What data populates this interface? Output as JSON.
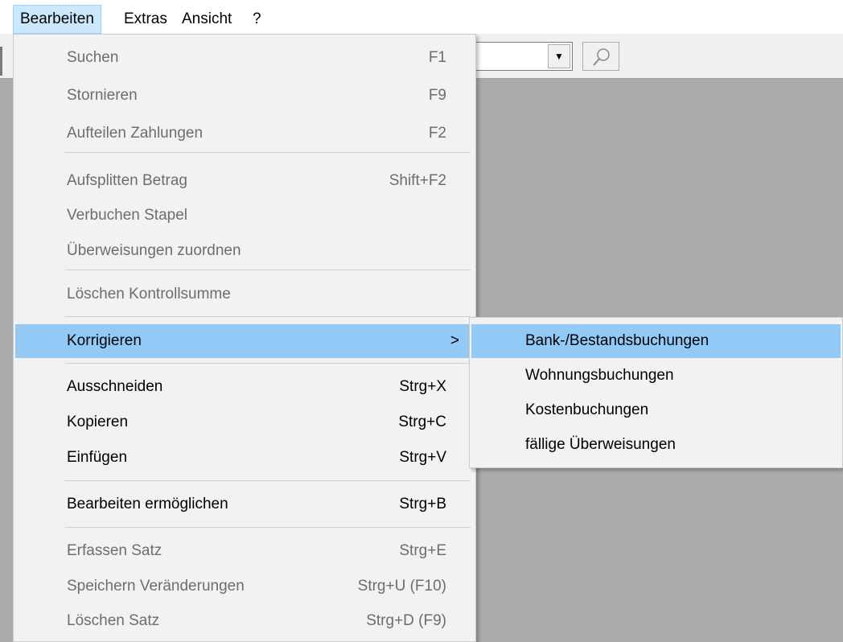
{
  "menubar": {
    "items": [
      {
        "label": "Bearbeiten",
        "active": true
      },
      {
        "label": "Extras"
      },
      {
        "label": "Ansicht"
      },
      {
        "label": "?"
      }
    ]
  },
  "colors": {
    "highlight": "#91c9f7",
    "menubar_active": "#cce8ff",
    "client_background": "#ababab",
    "disabled_text": "#6d6d6d"
  },
  "toolbar": {
    "combo_arrow_icon": "dropdown-arrow-icon",
    "search_icon": "magnifier-icon"
  },
  "menu": {
    "items": [
      {
        "label": "Suchen",
        "shortcut": "F1",
        "disabled": true
      },
      {
        "label": "Stornieren",
        "shortcut": "F9",
        "disabled": true
      },
      {
        "label": "Aufteilen Zahlungen",
        "shortcut": "F2",
        "disabled": true
      },
      {
        "label": "Aufsplitten Betrag",
        "shortcut": "Shift+F2",
        "disabled": true
      },
      {
        "label": "Verbuchen Stapel",
        "shortcut": "",
        "disabled": true
      },
      {
        "label": "Überweisungen zuordnen",
        "shortcut": "",
        "disabled": true
      },
      {
        "label": "Löschen Kontrollsumme",
        "shortcut": "",
        "disabled": true
      },
      {
        "label": "Korrigieren",
        "shortcut": "",
        "submenu": true,
        "highlighted": true
      },
      {
        "label": "Ausschneiden",
        "shortcut": "Strg+X"
      },
      {
        "label": "Kopieren",
        "shortcut": "Strg+C"
      },
      {
        "label": "Einfügen",
        "shortcut": "Strg+V"
      },
      {
        "label": "Bearbeiten ermöglichen",
        "shortcut": "Strg+B"
      },
      {
        "label": "Erfassen Satz",
        "shortcut": "Strg+E",
        "disabled": true
      },
      {
        "label": "Speichern Veränderungen",
        "shortcut": "Strg+U (F10)",
        "disabled": true
      },
      {
        "label": "Löschen Satz",
        "shortcut": "Strg+D (F9)",
        "disabled": true
      }
    ],
    "submenu_chevron": ">"
  },
  "submenu": {
    "items": [
      {
        "label": "Bank-/Bestandsbuchungen",
        "highlighted": true
      },
      {
        "label": "Wohnungsbuchungen"
      },
      {
        "label": "Kostenbuchungen"
      },
      {
        "label": "fällige Überweisungen"
      }
    ]
  }
}
